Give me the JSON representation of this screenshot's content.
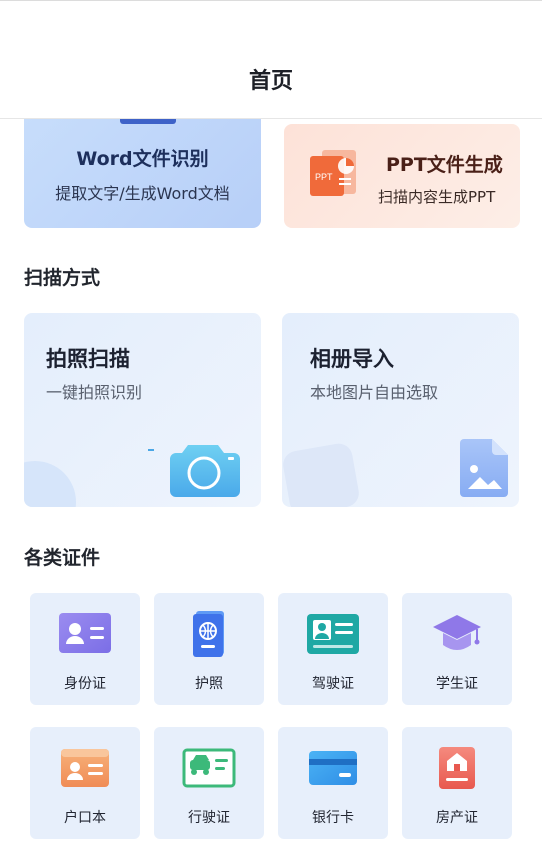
{
  "header": {
    "title": "首页"
  },
  "features": [
    {
      "title": "Word文件识别",
      "subtitle": "提取文字/生成Word文档",
      "icon": "word-doc-icon"
    },
    {
      "title": "PPT文件生成",
      "subtitle": "扫描内容生成PPT",
      "icon": "ppt-icon",
      "icon_text": "PPT"
    }
  ],
  "scan_section": {
    "title": "扫描方式",
    "cards": [
      {
        "title": "拍照扫描",
        "subtitle": "一键拍照识别",
        "icon": "camera-icon"
      },
      {
        "title": "相册导入",
        "subtitle": "本地图片自由选取",
        "icon": "image-file-icon"
      }
    ]
  },
  "doc_section": {
    "title": "各类证件",
    "items": [
      {
        "label": "身份证",
        "icon": "id-card-icon"
      },
      {
        "label": "护照",
        "icon": "passport-icon"
      },
      {
        "label": "驾驶证",
        "icon": "driver-license-icon"
      },
      {
        "label": "学生证",
        "icon": "graduation-cap-icon"
      },
      {
        "label": "户口本",
        "icon": "household-register-icon"
      },
      {
        "label": "行驶证",
        "icon": "vehicle-license-icon"
      },
      {
        "label": "银行卡",
        "icon": "bank-card-icon"
      },
      {
        "label": "房产证",
        "icon": "property-certificate-icon"
      }
    ]
  },
  "colors": {
    "accent_blue": "#4a7cf0",
    "ppt_orange": "#f06a3a",
    "card_bg": "#e7effb"
  }
}
